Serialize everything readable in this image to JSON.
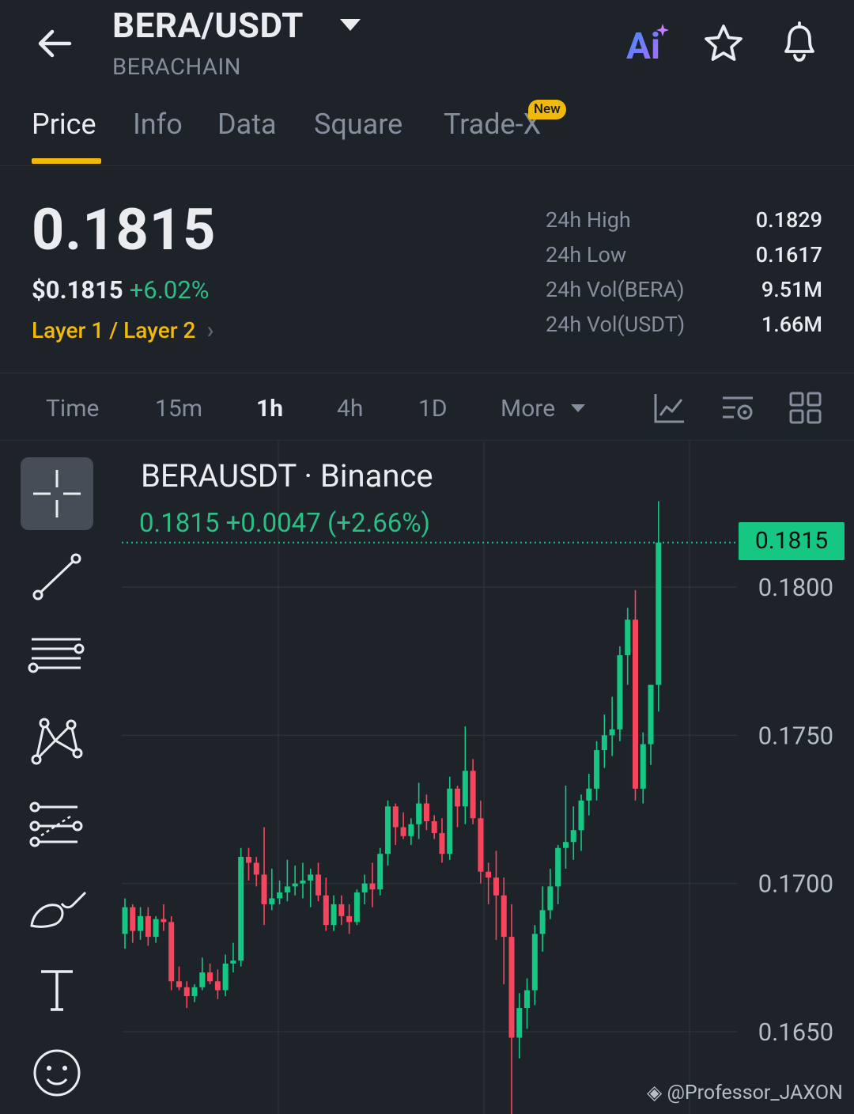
{
  "header": {
    "pair": "BERA/USDT",
    "chain": "BERACHAIN"
  },
  "tabs": [
    {
      "label": "Price",
      "active": true
    },
    {
      "label": "Info"
    },
    {
      "label": "Data"
    },
    {
      "label": "Square"
    },
    {
      "label": "Trade-X",
      "badge": "New"
    }
  ],
  "price": {
    "last": "0.1815",
    "usd": "$0.1815",
    "change_pct": "+6.02%",
    "category": "Layer 1 / Layer 2",
    "stats": [
      {
        "label": "24h High",
        "value": "0.1829"
      },
      {
        "label": "24h Low",
        "value": "0.1617"
      },
      {
        "label": "24h Vol(BERA)",
        "value": "9.51M"
      },
      {
        "label": "24h Vol(USDT)",
        "value": "1.66M"
      }
    ]
  },
  "intervals": {
    "items": [
      "Time",
      "15m",
      "1h",
      "4h",
      "1D",
      "More"
    ],
    "active": "1h"
  },
  "chart": {
    "title": "BERAUSDT · Binance",
    "quote": "0.1815  +0.0047 (+2.66%)",
    "last_price_tag": "0.1815",
    "y_ticks": [
      "0.1800",
      "0.1750",
      "0.1700",
      "0.1650"
    ],
    "watermark": "@Professor_JAXON"
  },
  "colors": {
    "bg": "#1e2329",
    "up": "#16c784",
    "down": "#f6465d",
    "accent": "#f0b90b"
  },
  "chart_data": {
    "type": "candlestick",
    "y_axis_ticks": [
      0.18,
      0.175,
      0.17,
      0.165
    ],
    "last": 0.1815,
    "candles": [
      {
        "o": 0.1683,
        "h": 0.1695,
        "l": 0.1678,
        "c": 0.1692
      },
      {
        "o": 0.1692,
        "h": 0.1693,
        "l": 0.168,
        "c": 0.1684
      },
      {
        "o": 0.1684,
        "h": 0.1692,
        "l": 0.1681,
        "c": 0.1689
      },
      {
        "o": 0.1689,
        "h": 0.1692,
        "l": 0.1679,
        "c": 0.1682
      },
      {
        "o": 0.1682,
        "h": 0.1689,
        "l": 0.168,
        "c": 0.1688
      },
      {
        "o": 0.1688,
        "h": 0.1693,
        "l": 0.1684,
        "c": 0.1687
      },
      {
        "o": 0.1687,
        "h": 0.1689,
        "l": 0.1664,
        "c": 0.1667
      },
      {
        "o": 0.1667,
        "h": 0.1672,
        "l": 0.1664,
        "c": 0.1665
      },
      {
        "o": 0.1665,
        "h": 0.1667,
        "l": 0.1658,
        "c": 0.1662
      },
      {
        "o": 0.1662,
        "h": 0.1666,
        "l": 0.166,
        "c": 0.1665
      },
      {
        "o": 0.1665,
        "h": 0.1675,
        "l": 0.1664,
        "c": 0.167
      },
      {
        "o": 0.167,
        "h": 0.1673,
        "l": 0.1666,
        "c": 0.1667
      },
      {
        "o": 0.1667,
        "h": 0.1671,
        "l": 0.1661,
        "c": 0.1664
      },
      {
        "o": 0.1664,
        "h": 0.1676,
        "l": 0.1662,
        "c": 0.1673
      },
      {
        "o": 0.1673,
        "h": 0.168,
        "l": 0.167,
        "c": 0.1674
      },
      {
        "o": 0.1674,
        "h": 0.1712,
        "l": 0.1672,
        "c": 0.1709
      },
      {
        "o": 0.1709,
        "h": 0.1712,
        "l": 0.1701,
        "c": 0.1707
      },
      {
        "o": 0.1707,
        "h": 0.1709,
        "l": 0.1699,
        "c": 0.1703
      },
      {
        "o": 0.1703,
        "h": 0.1719,
        "l": 0.1686,
        "c": 0.1693
      },
      {
        "o": 0.1693,
        "h": 0.1705,
        "l": 0.1691,
        "c": 0.1695
      },
      {
        "o": 0.1695,
        "h": 0.1701,
        "l": 0.1693,
        "c": 0.1697
      },
      {
        "o": 0.1697,
        "h": 0.1708,
        "l": 0.1694,
        "c": 0.1699
      },
      {
        "o": 0.1699,
        "h": 0.1706,
        "l": 0.1696,
        "c": 0.17
      },
      {
        "o": 0.17,
        "h": 0.1707,
        "l": 0.1695,
        "c": 0.1701
      },
      {
        "o": 0.1701,
        "h": 0.1705,
        "l": 0.1692,
        "c": 0.1703
      },
      {
        "o": 0.1703,
        "h": 0.1707,
        "l": 0.1694,
        "c": 0.1696
      },
      {
        "o": 0.1696,
        "h": 0.1702,
        "l": 0.1684,
        "c": 0.1686
      },
      {
        "o": 0.1686,
        "h": 0.1696,
        "l": 0.1684,
        "c": 0.1693
      },
      {
        "o": 0.1693,
        "h": 0.1696,
        "l": 0.1686,
        "c": 0.1689
      },
      {
        "o": 0.1689,
        "h": 0.1693,
        "l": 0.1683,
        "c": 0.1687
      },
      {
        "o": 0.1687,
        "h": 0.1698,
        "l": 0.1686,
        "c": 0.1697
      },
      {
        "o": 0.1697,
        "h": 0.1703,
        "l": 0.1693,
        "c": 0.17
      },
      {
        "o": 0.17,
        "h": 0.1707,
        "l": 0.1692,
        "c": 0.1698
      },
      {
        "o": 0.1698,
        "h": 0.1712,
        "l": 0.1696,
        "c": 0.171
      },
      {
        "o": 0.171,
        "h": 0.1728,
        "l": 0.1706,
        "c": 0.1726
      },
      {
        "o": 0.1726,
        "h": 0.1727,
        "l": 0.1713,
        "c": 0.1719
      },
      {
        "o": 0.1719,
        "h": 0.1724,
        "l": 0.1715,
        "c": 0.1716
      },
      {
        "o": 0.1716,
        "h": 0.1722,
        "l": 0.1713,
        "c": 0.172
      },
      {
        "o": 0.172,
        "h": 0.1734,
        "l": 0.1715,
        "c": 0.1727
      },
      {
        "o": 0.1727,
        "h": 0.173,
        "l": 0.1718,
        "c": 0.1721
      },
      {
        "o": 0.1721,
        "h": 0.1723,
        "l": 0.1715,
        "c": 0.1717
      },
      {
        "o": 0.1717,
        "h": 0.1722,
        "l": 0.1707,
        "c": 0.171
      },
      {
        "o": 0.171,
        "h": 0.1736,
        "l": 0.1708,
        "c": 0.1732
      },
      {
        "o": 0.1732,
        "h": 0.1733,
        "l": 0.1719,
        "c": 0.1726
      },
      {
        "o": 0.1726,
        "h": 0.1753,
        "l": 0.172,
        "c": 0.1738
      },
      {
        "o": 0.1738,
        "h": 0.1742,
        "l": 0.172,
        "c": 0.1722
      },
      {
        "o": 0.1722,
        "h": 0.1728,
        "l": 0.17,
        "c": 0.1704
      },
      {
        "o": 0.1704,
        "h": 0.1707,
        "l": 0.1693,
        "c": 0.1702
      },
      {
        "o": 0.1702,
        "h": 0.1711,
        "l": 0.1681,
        "c": 0.1696
      },
      {
        "o": 0.1696,
        "h": 0.1702,
        "l": 0.1666,
        "c": 0.1682
      },
      {
        "o": 0.1682,
        "h": 0.1693,
        "l": 0.1618,
        "c": 0.1648
      },
      {
        "o": 0.1648,
        "h": 0.1663,
        "l": 0.1641,
        "c": 0.1658
      },
      {
        "o": 0.1658,
        "h": 0.1668,
        "l": 0.1651,
        "c": 0.1664
      },
      {
        "o": 0.1664,
        "h": 0.1686,
        "l": 0.1659,
        "c": 0.1683
      },
      {
        "o": 0.1683,
        "h": 0.1699,
        "l": 0.1677,
        "c": 0.1691
      },
      {
        "o": 0.1691,
        "h": 0.1705,
        "l": 0.1688,
        "c": 0.1699
      },
      {
        "o": 0.1699,
        "h": 0.1713,
        "l": 0.1693,
        "c": 0.1712
      },
      {
        "o": 0.1712,
        "h": 0.1733,
        "l": 0.1705,
        "c": 0.1714
      },
      {
        "o": 0.1714,
        "h": 0.1726,
        "l": 0.1708,
        "c": 0.1718
      },
      {
        "o": 0.1718,
        "h": 0.173,
        "l": 0.1711,
        "c": 0.1728
      },
      {
        "o": 0.1728,
        "h": 0.1737,
        "l": 0.1723,
        "c": 0.1732
      },
      {
        "o": 0.1732,
        "h": 0.1748,
        "l": 0.1728,
        "c": 0.1745
      },
      {
        "o": 0.1745,
        "h": 0.1757,
        "l": 0.1739,
        "c": 0.175
      },
      {
        "o": 0.175,
        "h": 0.1763,
        "l": 0.1743,
        "c": 0.1752
      },
      {
        "o": 0.1752,
        "h": 0.178,
        "l": 0.1748,
        "c": 0.1777
      },
      {
        "o": 0.1777,
        "h": 0.1793,
        "l": 0.1767,
        "c": 0.1789
      },
      {
        "o": 0.1789,
        "h": 0.1799,
        "l": 0.1728,
        "c": 0.1732
      },
      {
        "o": 0.1732,
        "h": 0.1751,
        "l": 0.1727,
        "c": 0.1747
      },
      {
        "o": 0.1747,
        "h": 0.1767,
        "l": 0.174,
        "c": 0.1767
      },
      {
        "o": 0.1767,
        "h": 0.1829,
        "l": 0.1758,
        "c": 0.1815
      }
    ]
  }
}
